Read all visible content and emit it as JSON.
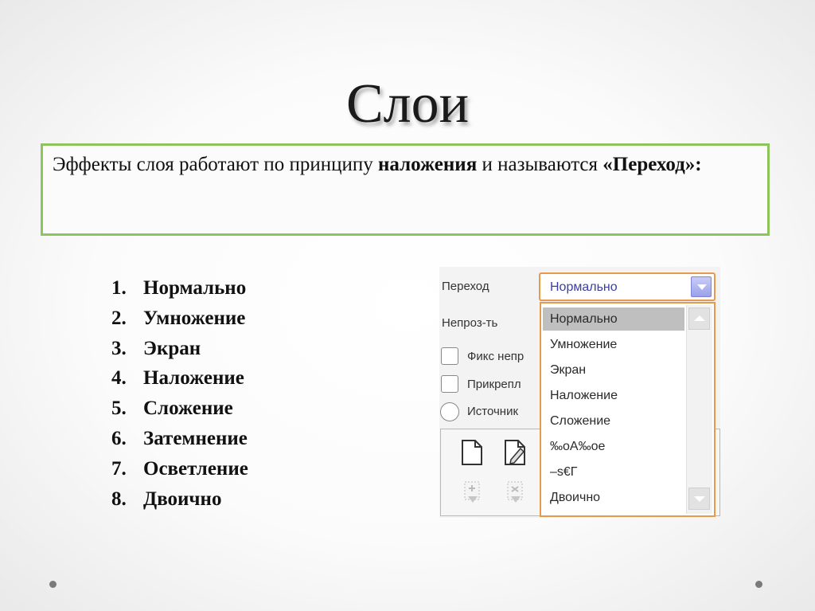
{
  "slide": {
    "title": "Слои",
    "text": {
      "part1": "Эффекты слоя работают по принципу ",
      "bold1": "наложения",
      "part2": " и называются ",
      "bold2": "«Переход»:"
    },
    "blend_modes": [
      {
        "num": "1.",
        "label": "Нормально"
      },
      {
        "num": "2.",
        "label": "Умножение"
      },
      {
        "num": "3.",
        "label": "Экран"
      },
      {
        "num": "4.",
        "label": "Наложение"
      },
      {
        "num": "5.",
        "label": "Сложение"
      },
      {
        "num": "6.",
        "label": "Затемнение"
      },
      {
        "num": "7.",
        "label": "Осветление"
      },
      {
        "num": "8.",
        "label": "Двоично"
      }
    ]
  },
  "layer_dialog": {
    "blend_label": "Переход",
    "blend_value": "Нормально",
    "opacity_label": "Непроз-ть",
    "checkbox1_label": "Фикс непр",
    "checkbox2_label": "Прикрепл",
    "radio_label": "Источник",
    "dropdown_options": [
      "Нормально",
      "Умножение",
      "Экран",
      "Наложение",
      "Сложение",
      "‰оА‰ое",
      "–s€Г",
      "Двоично"
    ],
    "selected_index": 0
  },
  "colors": {
    "textbox_border": "#8dc45b",
    "combo_border": "#e59a4c",
    "combo_button": "#9aa1ea",
    "selected_option": "#bfbfbf"
  }
}
